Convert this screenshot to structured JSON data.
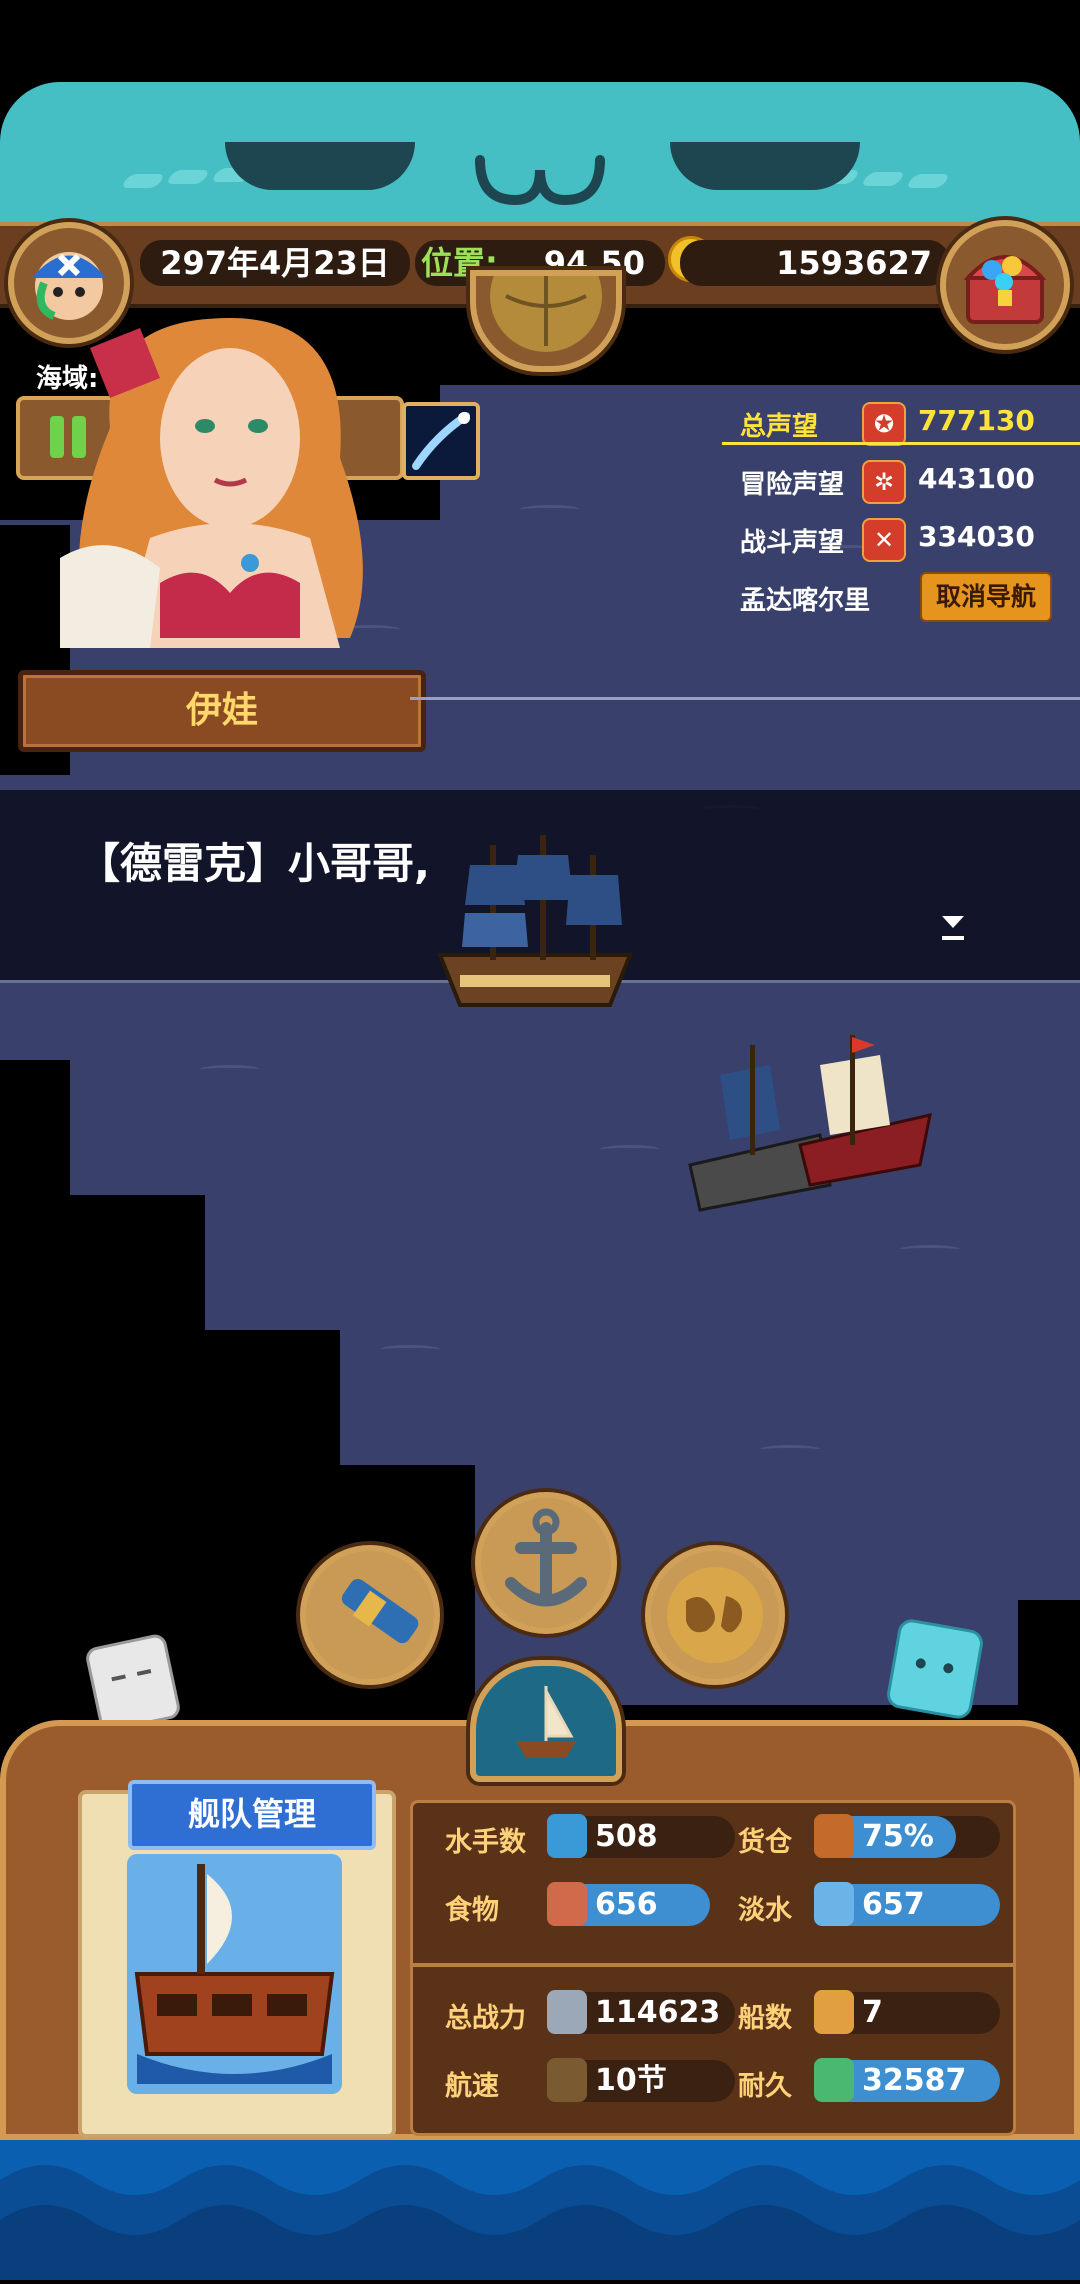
{
  "hud": {
    "date": "297年4月23日",
    "position_label": "位置:",
    "position_value": "94,50",
    "gold": "1593627"
  },
  "region_label": "海域:",
  "character": {
    "name": "伊娃"
  },
  "reputation": {
    "total_label": "总声望",
    "total_value": "777130",
    "adventure_label": "冒险声望",
    "adventure_value": "443100",
    "battle_label": "战斗声望",
    "battle_value": "334030",
    "destination": "孟达喀尔里",
    "cancel_nav_label": "取消导航"
  },
  "dialog": {
    "text": "【德雷克】小哥哥,"
  },
  "fleet": {
    "title": "舰队管理",
    "stats": [
      {
        "label": "水手数",
        "value": "508",
        "fill": 0.0
      },
      {
        "label": "货仓",
        "value": "75%",
        "fill": 0.75
      },
      {
        "label": "食物",
        "value": "656",
        "fill": 1.0
      },
      {
        "label": "淡水",
        "value": "657",
        "fill": 1.0
      },
      {
        "label": "总战力",
        "value": "114623",
        "fill": 0.0
      },
      {
        "label": "船数",
        "value": "7",
        "fill": 0.0
      },
      {
        "label": "航速",
        "value": "10节",
        "fill": 0.0
      },
      {
        "label": "耐久",
        "value": "32587",
        "fill": 1.0
      }
    ]
  },
  "colors": {
    "cat_band": "#45bfc4",
    "sea": "#39406b",
    "hud_wood": "#6b3e1f",
    "stat_blue": "#3d8fd1",
    "rep_total_yellow": "#ffe23a",
    "name_gold": "#ffd76b"
  },
  "icons": {
    "avatar": "pirate-avatar-icon",
    "treasure": "treasure-chest-icon",
    "globe": "globe-icon",
    "spyglass": "spyglass-icon",
    "anchor": "anchor-icon",
    "map": "world-map-icon",
    "sail": "sailboat-icon"
  }
}
